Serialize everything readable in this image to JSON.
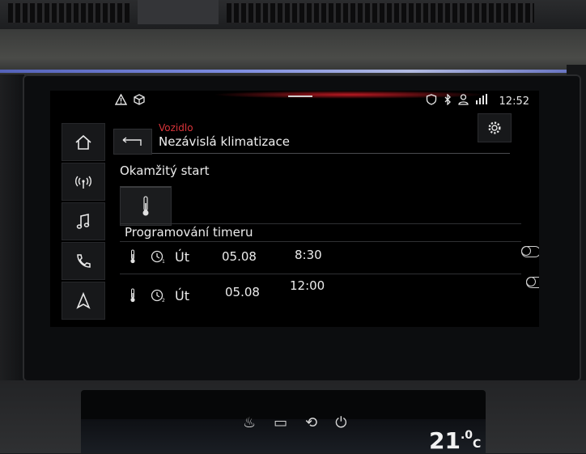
{
  "status": {
    "time": "12:52",
    "icons": [
      "warning-icon",
      "car-package-icon",
      "shield-icon",
      "bluetooth-icon",
      "user-icon",
      "lte-icon"
    ]
  },
  "nav": {
    "items": [
      {
        "name": "home",
        "icon": "home-icon"
      },
      {
        "name": "connectivity",
        "icon": "radio-signal-icon"
      },
      {
        "name": "media",
        "icon": "music-note-icon"
      },
      {
        "name": "phone",
        "icon": "phone-icon"
      },
      {
        "name": "navigation",
        "icon": "navigation-arrow-icon"
      }
    ]
  },
  "header": {
    "breadcrumb": "Vozidlo",
    "title": "Nezávislá klimatizace"
  },
  "instant_start": {
    "label": "Okamžitý start"
  },
  "timer": {
    "label": "Programování timeru",
    "rows": [
      {
        "timer_no": "1",
        "day": "Út",
        "date": "05.08",
        "time": "8:30",
        "enabled": false
      },
      {
        "timer_no": "2",
        "day": "Út",
        "date": "05.08",
        "time": "12:00",
        "enabled": false
      }
    ]
  },
  "lower_display": {
    "temperature": "21",
    "decimal": ".0",
    "unit": "C"
  }
}
